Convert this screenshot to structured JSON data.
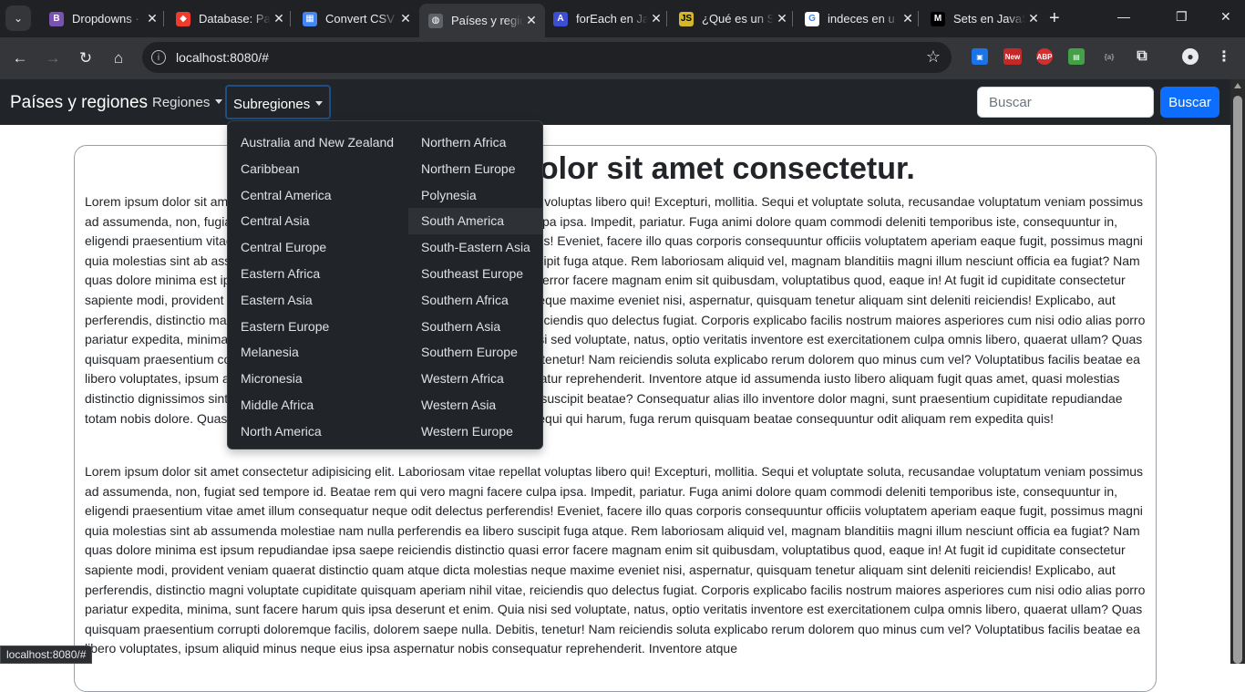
{
  "browser": {
    "tabs": [
      {
        "title": "Dropdowns ·",
        "favicon": "bootstrap-icon",
        "color": "#7952b3",
        "glyph": "B"
      },
      {
        "title": "Database: Pa",
        "favicon": "laravel-icon",
        "color": "#ef3b2d",
        "glyph": "◆"
      },
      {
        "title": "Convert CSV",
        "favicon": "grid-icon",
        "color": "#4285f4",
        "glyph": "▦"
      },
      {
        "title": "Países y regio",
        "favicon": "globe-icon",
        "color": "#5f6368",
        "glyph": "◍",
        "active": true
      },
      {
        "title": "forEach en Ja",
        "favicon": "a-icon",
        "color": "#3c4fd4",
        "glyph": "A"
      },
      {
        "title": "¿Qué es un S",
        "favicon": "js-icon",
        "color": "#d6b729",
        "glyph": "JS"
      },
      {
        "title": "indeces en u",
        "favicon": "google-icon",
        "color": "#ffffff",
        "glyph": "G"
      },
      {
        "title": "Sets en JavaS",
        "favicon": "medium-icon",
        "color": "#000000",
        "glyph": "M"
      }
    ],
    "url": "localhost:8080/#",
    "status_url": "localhost:8080/#",
    "extension_badge": "New"
  },
  "navbar": {
    "brand": "Países y regiones",
    "regiones_label": "Regiones",
    "subregiones_label": "Subregiones",
    "search_placeholder": "Buscar",
    "search_button": "Buscar"
  },
  "subregions": {
    "left": [
      "Australia and New Zealand",
      "Caribbean",
      "Central America",
      "Central Asia",
      "Central Europe",
      "Eastern Africa",
      "Eastern Asia",
      "Eastern Europe",
      "Melanesia",
      "Micronesia",
      "Middle Africa",
      "North America"
    ],
    "right": [
      "Northern Africa",
      "Northern Europe",
      "Polynesia",
      "South America",
      "South-Eastern Asia",
      "Southeast Europe",
      "Southern Africa",
      "Southern Asia",
      "Southern Europe",
      "Western Africa",
      "Western Asia",
      "Western Europe"
    ],
    "hovered": "South America"
  },
  "content": {
    "heading": "Lorem ipsum dolor sit amet consectetur.",
    "paragraphs": [
      "Lorem ipsum dolor sit amet consectetur adipisicing elit. Laboriosam vitae repellat voluptas libero qui! Excepturi, mollitia. Sequi et voluptate soluta, recusandae voluptatum veniam possimus ad assumenda, non, fugiat sed tempore id. Beatae rem qui vero magni facere culpa ipsa. Impedit, pariatur. Fuga animi dolore quam commodi deleniti temporibus iste, consequuntur in, eligendi praesentium vitae amet illum consequatur neque odit delectus perferendis! Eveniet, facere illo quas corporis consequuntur officiis voluptatem aperiam eaque fugit, possimus magni quia molestias sint ab assumenda molestiae nam nulla perferendis ea libero suscipit fuga atque. Rem laboriosam aliquid vel, magnam blanditiis magni illum nesciunt officia ea fugiat? Nam quas dolore minima est ipsum repudiandae ipsa saepe reiciendis distinctio quasi error facere magnam enim sit quibusdam, voluptatibus quod, eaque in! At fugit id cupiditate consectetur sapiente modi, provident veniam quaerat distinctio quam atque dicta molestias neque maxime eveniet nisi, aspernatur, quisquam tenetur aliquam sint deleniti reiciendis! Explicabo, aut perferendis, distinctio magni voluptate cupiditate quisquam aperiam nihil vitae, reiciendis quo delectus fugiat. Corporis explicabo facilis nostrum maiores asperiores cum nisi odio alias porro pariatur expedita, minima, sunt facere harum quis ipsa deserunt et enim. Quia nisi sed voluptate, natus, optio veritatis inventore est exercitationem culpa omnis libero, quaerat ullam? Quas quisquam praesentium corrupti doloremque facilis, dolorem saepe nulla. Debitis, tenetur! Nam reiciendis soluta explicabo rerum dolorem quo minus cum vel? Voluptatibus facilis beatae ea libero voluptates, ipsum aliquid minus neque eius ipsa aspernatur nobis consequatur reprehenderit. Inventore atque id assumenda iusto libero aliquam fugit quas amet, quasi molestias distinctio dignissimos sint adipisci at alias esse vitae, dolore deleniti voluptatibus suscipit beatae? Consequatur alias illo inventore dolor magni, sunt praesentium cupiditate repudiandae totam nobis dolore. Quas similique quasi eligendi dicta. Eum eius debitis natus sequi qui harum, fuga rerum quisquam beatae consequuntur odit aliquam rem expedita quis!",
      "Lorem ipsum dolor sit amet consectetur adipisicing elit. Laboriosam vitae repellat voluptas libero qui! Excepturi, mollitia. Sequi et voluptate soluta, recusandae voluptatum veniam possimus ad assumenda, non, fugiat sed tempore id. Beatae rem qui vero magni facere culpa ipsa. Impedit, pariatur. Fuga animi dolore quam commodi deleniti temporibus iste, consequuntur in, eligendi praesentium vitae amet illum consequatur neque odit delectus perferendis! Eveniet, facere illo quas corporis consequuntur officiis voluptatem aperiam eaque fugit, possimus magni quia molestias sint ab assumenda molestiae nam nulla perferendis ea libero suscipit fuga atque. Rem laboriosam aliquid vel, magnam blanditiis magni illum nesciunt officia ea fugiat? Nam quas dolore minima est ipsum repudiandae ipsa saepe reiciendis distinctio quasi error facere magnam enim sit quibusdam, voluptatibus quod, eaque in! At fugit id cupiditate consectetur sapiente modi, provident veniam quaerat distinctio quam atque dicta molestias neque maxime eveniet nisi, aspernatur, quisquam tenetur aliquam sint deleniti reiciendis! Explicabo, aut perferendis, distinctio magni voluptate cupiditate quisquam aperiam nihil vitae, reiciendis quo delectus fugiat. Corporis explicabo facilis nostrum maiores asperiores cum nisi odio alias porro pariatur expedita, minima, sunt facere harum quis ipsa deserunt et enim. Quia nisi sed voluptate, natus, optio veritatis inventore est exercitationem culpa omnis libero, quaerat ullam? Quas quisquam praesentium corrupti doloremque facilis, dolorem saepe nulla. Debitis, tenetur! Nam reiciendis soluta explicabo rerum dolorem quo minus cum vel? Voluptatibus facilis beatae ea libero voluptates, ipsum aliquid minus neque eius ipsa aspernatur nobis consequatur reprehenderit. Inventore atque"
    ]
  }
}
